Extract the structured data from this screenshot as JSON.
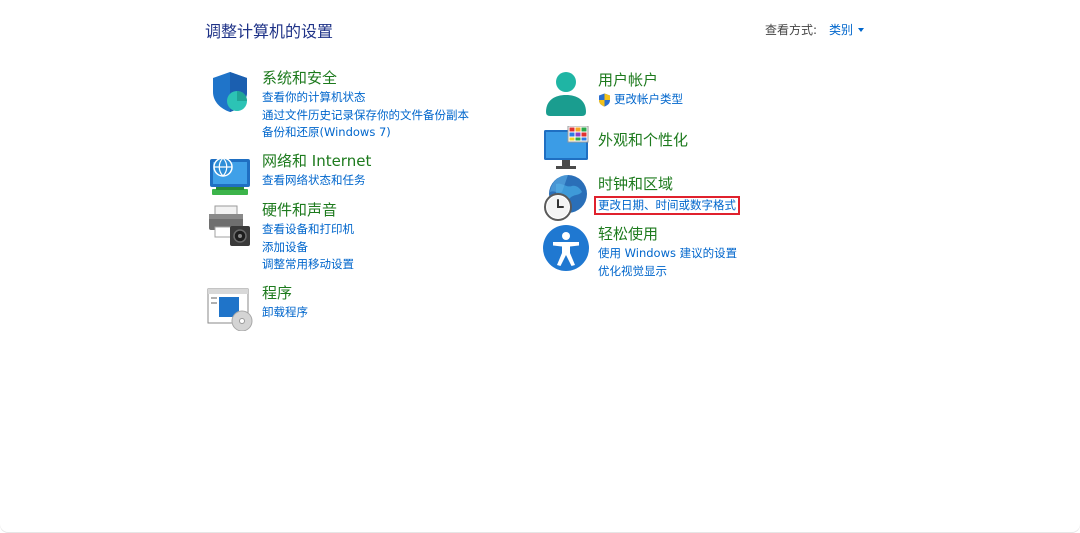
{
  "page": {
    "title": "调整计算机的设置"
  },
  "view_by": {
    "label": "查看方式:",
    "value": "类别"
  },
  "left_column": [
    {
      "id": "system-security",
      "title": "系统和安全",
      "icon": "shield-icon",
      "links": [
        "查看你的计算机状态",
        "通过文件历史记录保存你的文件备份副本",
        "备份和还原(Windows 7)"
      ]
    },
    {
      "id": "network-internet",
      "title": "网络和 Internet",
      "icon": "network-globe-icon",
      "links": [
        "查看网络状态和任务"
      ]
    },
    {
      "id": "hardware-sound",
      "title": "硬件和声音",
      "icon": "printer-speaker-icon",
      "links": [
        "查看设备和打印机",
        "添加设备",
        "调整常用移动设置"
      ]
    },
    {
      "id": "programs",
      "title": "程序",
      "icon": "programs-disc-icon",
      "links": [
        "卸载程序"
      ]
    }
  ],
  "right_column": [
    {
      "id": "user-accounts",
      "title": "用户帐户",
      "icon": "user-icon",
      "links": [
        "更改帐户类型"
      ]
    },
    {
      "id": "appearance",
      "title": "外观和个性化",
      "icon": "monitor-palette-icon",
      "links": []
    },
    {
      "id": "clock-region",
      "title": "时钟和区域",
      "icon": "clock-globe-icon",
      "links": [
        "更改日期、时间或数字格式"
      ]
    },
    {
      "id": "ease-of-access",
      "title": "轻松使用",
      "icon": "accessibility-icon",
      "links": [
        "使用 Windows 建议的设置",
        "优化视觉显示"
      ]
    }
  ],
  "colors": {
    "title_blue": "#1e3287",
    "category_green": "#1d7a1d",
    "link_blue": "#0066cc",
    "highlight_red": "#e0212d"
  }
}
